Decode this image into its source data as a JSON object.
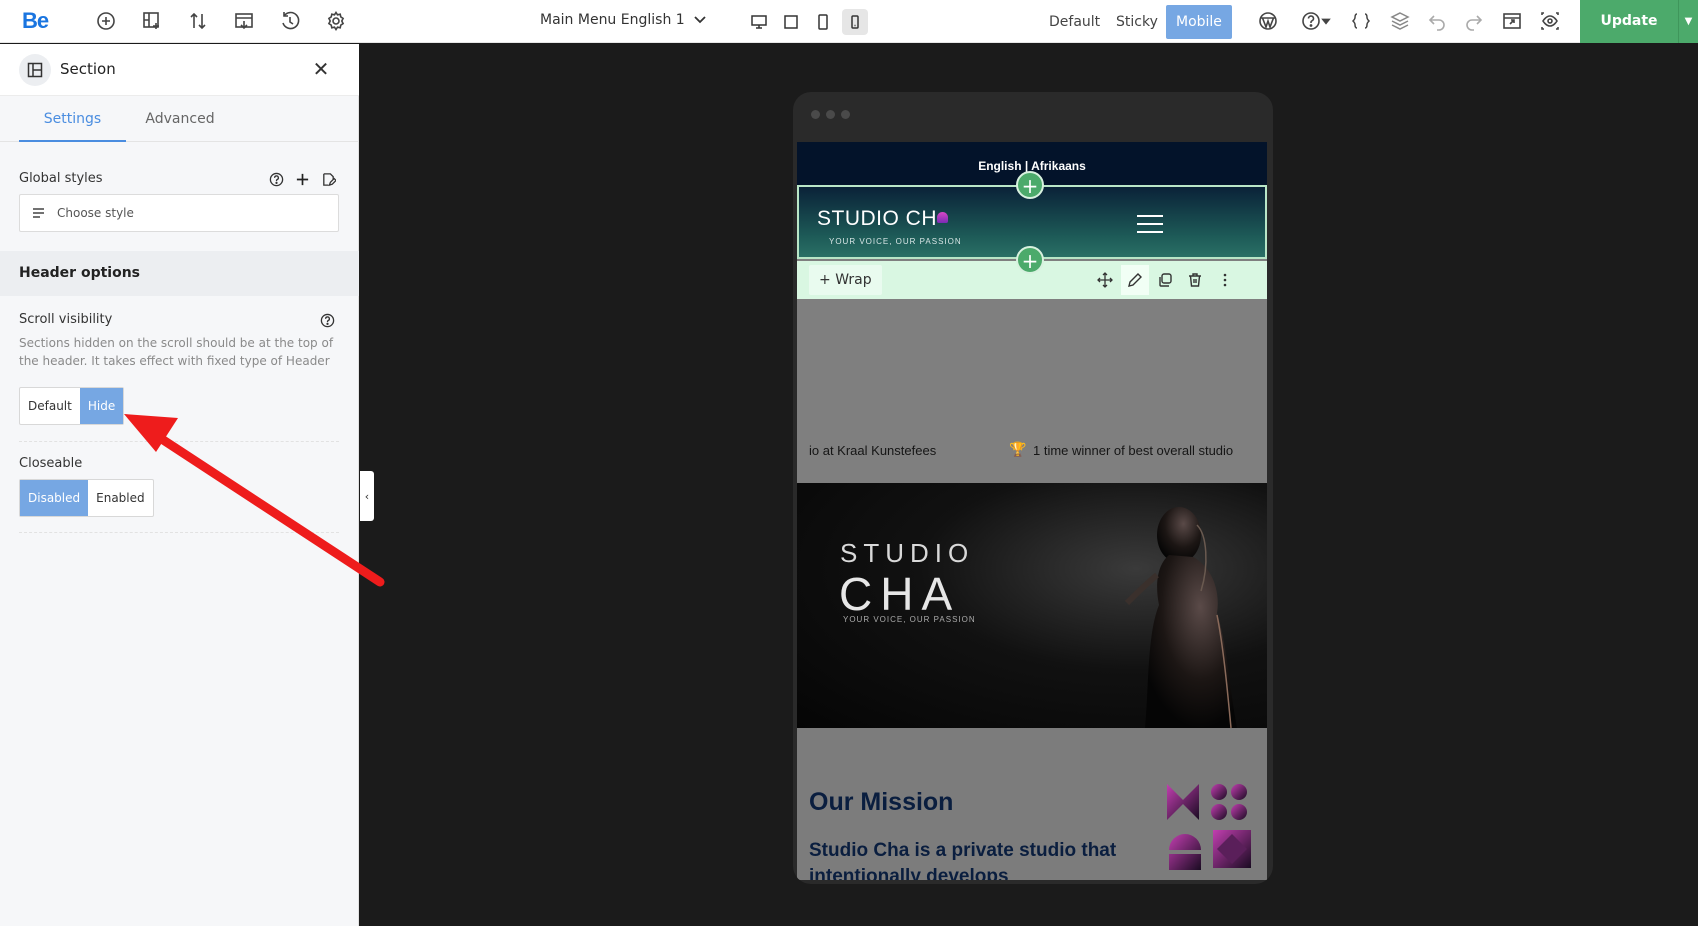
{
  "toolbar": {
    "logo": "Be",
    "menu_select": "Main Menu English 1",
    "modes": [
      "Default",
      "Sticky",
      "Mobile"
    ],
    "active_mode": "Mobile",
    "update_label": "Update"
  },
  "panel": {
    "title": "Section",
    "tabs": [
      "Settings",
      "Advanced"
    ],
    "global_styles_label": "Global styles",
    "choose_style_placeholder": "Choose style",
    "header_options": "Header options",
    "scroll_visibility_label": "Scroll visibility",
    "scroll_visibility_desc": "Sections hidden on the scroll should be at the top of the header. It takes effect with fixed type of Header",
    "scroll_options": [
      "Default",
      "Hide"
    ],
    "scroll_selected": "Hide",
    "closeable_label": "Closeable",
    "closeable_options": [
      "Disabled",
      "Enabled"
    ],
    "closeable_selected": "Disabled"
  },
  "preview": {
    "lang_bar": "English | Afrikaans",
    "brand": "STUDIO CH",
    "tagline": "YOUR VOICE, OUR PASSION",
    "wrap_label": "Wrap",
    "marquee_left": "io at Kraal Kunstefees",
    "marquee_right": "1 time winner of best overall studio",
    "hero_line1": "STUDIO",
    "hero_line2": "CHA",
    "hero_tag": "YOUR VOICE, OUR PASSION",
    "mission_title": "Our Mission",
    "mission_text": "Studio Cha is a private studio that intentionally develops"
  },
  "colors": {
    "accent": "#76a7e3",
    "update_green": "#4caa6b",
    "arrow_red": "#ee1c1c"
  }
}
